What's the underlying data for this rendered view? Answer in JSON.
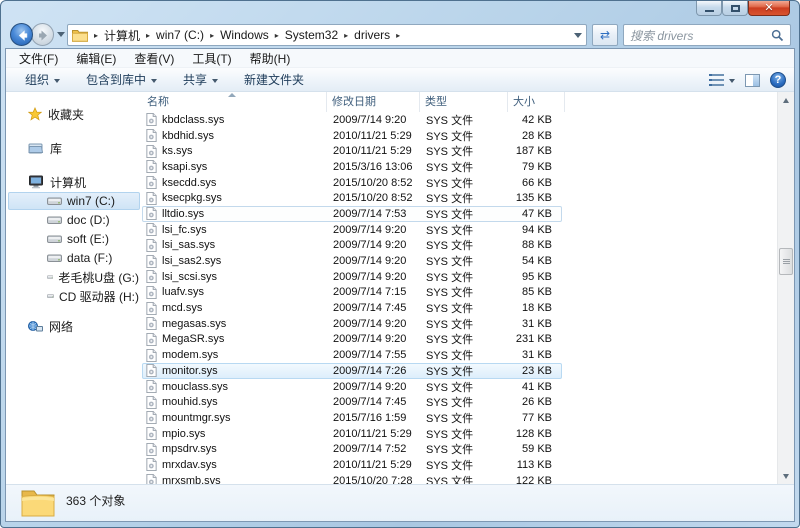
{
  "colors": {
    "accent_blue": "#2f6fc1",
    "close_red": "#cb3d20",
    "folder_yellow": "#f5d376",
    "selection_blue": "#cfe4f6"
  },
  "search": {
    "placeholder": "搜索 drivers"
  },
  "breadcrumb": {
    "segments": [
      "计算机",
      "win7 (C:)",
      "Windows",
      "System32",
      "drivers"
    ]
  },
  "menu_bar": {
    "items": [
      "文件(F)",
      "编辑(E)",
      "查看(V)",
      "工具(T)",
      "帮助(H)"
    ]
  },
  "toolbar": {
    "buttons": [
      {
        "label": "组织",
        "dropdown": true
      },
      {
        "label": "包含到库中",
        "dropdown": true
      },
      {
        "label": "共享",
        "dropdown": true
      },
      {
        "label": "新建文件夹",
        "dropdown": false
      }
    ]
  },
  "sidebar": {
    "favorites": "收藏夹",
    "libraries": "库",
    "computer": "计算机",
    "drives": [
      {
        "label": "win7 (C:)",
        "selected": true
      },
      {
        "label": "doc (D:)",
        "selected": false
      },
      {
        "label": "soft (E:)",
        "selected": false
      },
      {
        "label": "data (F:)",
        "selected": false
      },
      {
        "label": "老毛桃U盘 (G:)",
        "selected": false
      },
      {
        "label": "CD 驱动器 (H:)",
        "selected": false
      }
    ],
    "network": "网络"
  },
  "filelist": {
    "columns": [
      "名称",
      "修改日期",
      "类型",
      "大小"
    ],
    "sort_column": "名称",
    "rows": [
      {
        "name": "kbdclass.sys",
        "date": "2009/7/14 9:20",
        "type": "SYS 文件",
        "size": "42 KB",
        "highlight": ""
      },
      {
        "name": "kbdhid.sys",
        "date": "2010/11/21 5:29",
        "type": "SYS 文件",
        "size": "28 KB",
        "highlight": ""
      },
      {
        "name": "ks.sys",
        "date": "2010/11/21 5:29",
        "type": "SYS 文件",
        "size": "187 KB",
        "highlight": ""
      },
      {
        "name": "ksapi.sys",
        "date": "2015/3/16 13:06",
        "type": "SYS 文件",
        "size": "79 KB",
        "highlight": ""
      },
      {
        "name": "ksecdd.sys",
        "date": "2015/10/20 8:52",
        "type": "SYS 文件",
        "size": "66 KB",
        "highlight": ""
      },
      {
        "name": "ksecpkg.sys",
        "date": "2015/10/20 8:52",
        "type": "SYS 文件",
        "size": "135 KB",
        "highlight": ""
      },
      {
        "name": "lltdio.sys",
        "date": "2009/7/14 7:53",
        "type": "SYS 文件",
        "size": "47 KB",
        "highlight": "focus"
      },
      {
        "name": "lsi_fc.sys",
        "date": "2009/7/14 9:20",
        "type": "SYS 文件",
        "size": "94 KB",
        "highlight": ""
      },
      {
        "name": "lsi_sas.sys",
        "date": "2009/7/14 9:20",
        "type": "SYS 文件",
        "size": "88 KB",
        "highlight": ""
      },
      {
        "name": "lsi_sas2.sys",
        "date": "2009/7/14 9:20",
        "type": "SYS 文件",
        "size": "54 KB",
        "highlight": ""
      },
      {
        "name": "lsi_scsi.sys",
        "date": "2009/7/14 9:20",
        "type": "SYS 文件",
        "size": "95 KB",
        "highlight": ""
      },
      {
        "name": "luafv.sys",
        "date": "2009/7/14 7:15",
        "type": "SYS 文件",
        "size": "85 KB",
        "highlight": ""
      },
      {
        "name": "mcd.sys",
        "date": "2009/7/14 7:45",
        "type": "SYS 文件",
        "size": "18 KB",
        "highlight": ""
      },
      {
        "name": "megasas.sys",
        "date": "2009/7/14 9:20",
        "type": "SYS 文件",
        "size": "31 KB",
        "highlight": ""
      },
      {
        "name": "MegaSR.sys",
        "date": "2009/7/14 9:20",
        "type": "SYS 文件",
        "size": "231 KB",
        "highlight": ""
      },
      {
        "name": "modem.sys",
        "date": "2009/7/14 7:55",
        "type": "SYS 文件",
        "size": "31 KB",
        "highlight": ""
      },
      {
        "name": "monitor.sys",
        "date": "2009/7/14 7:26",
        "type": "SYS 文件",
        "size": "23 KB",
        "highlight": "hover"
      },
      {
        "name": "mouclass.sys",
        "date": "2009/7/14 9:20",
        "type": "SYS 文件",
        "size": "41 KB",
        "highlight": ""
      },
      {
        "name": "mouhid.sys",
        "date": "2009/7/14 7:45",
        "type": "SYS 文件",
        "size": "26 KB",
        "highlight": ""
      },
      {
        "name": "mountmgr.sys",
        "date": "2015/7/16 1:59",
        "type": "SYS 文件",
        "size": "77 KB",
        "highlight": ""
      },
      {
        "name": "mpio.sys",
        "date": "2010/11/21 5:29",
        "type": "SYS 文件",
        "size": "128 KB",
        "highlight": ""
      },
      {
        "name": "mpsdrv.sys",
        "date": "2009/7/14 7:52",
        "type": "SYS 文件",
        "size": "59 KB",
        "highlight": ""
      },
      {
        "name": "mrxdav.sys",
        "date": "2010/11/21 5:29",
        "type": "SYS 文件",
        "size": "113 KB",
        "highlight": ""
      },
      {
        "name": "mrxsmb.sys",
        "date": "2015/10/20 7:28",
        "type": "SYS 文件",
        "size": "122 KB",
        "highlight": ""
      }
    ]
  },
  "statusbar": {
    "item_count": "363 个对象"
  }
}
